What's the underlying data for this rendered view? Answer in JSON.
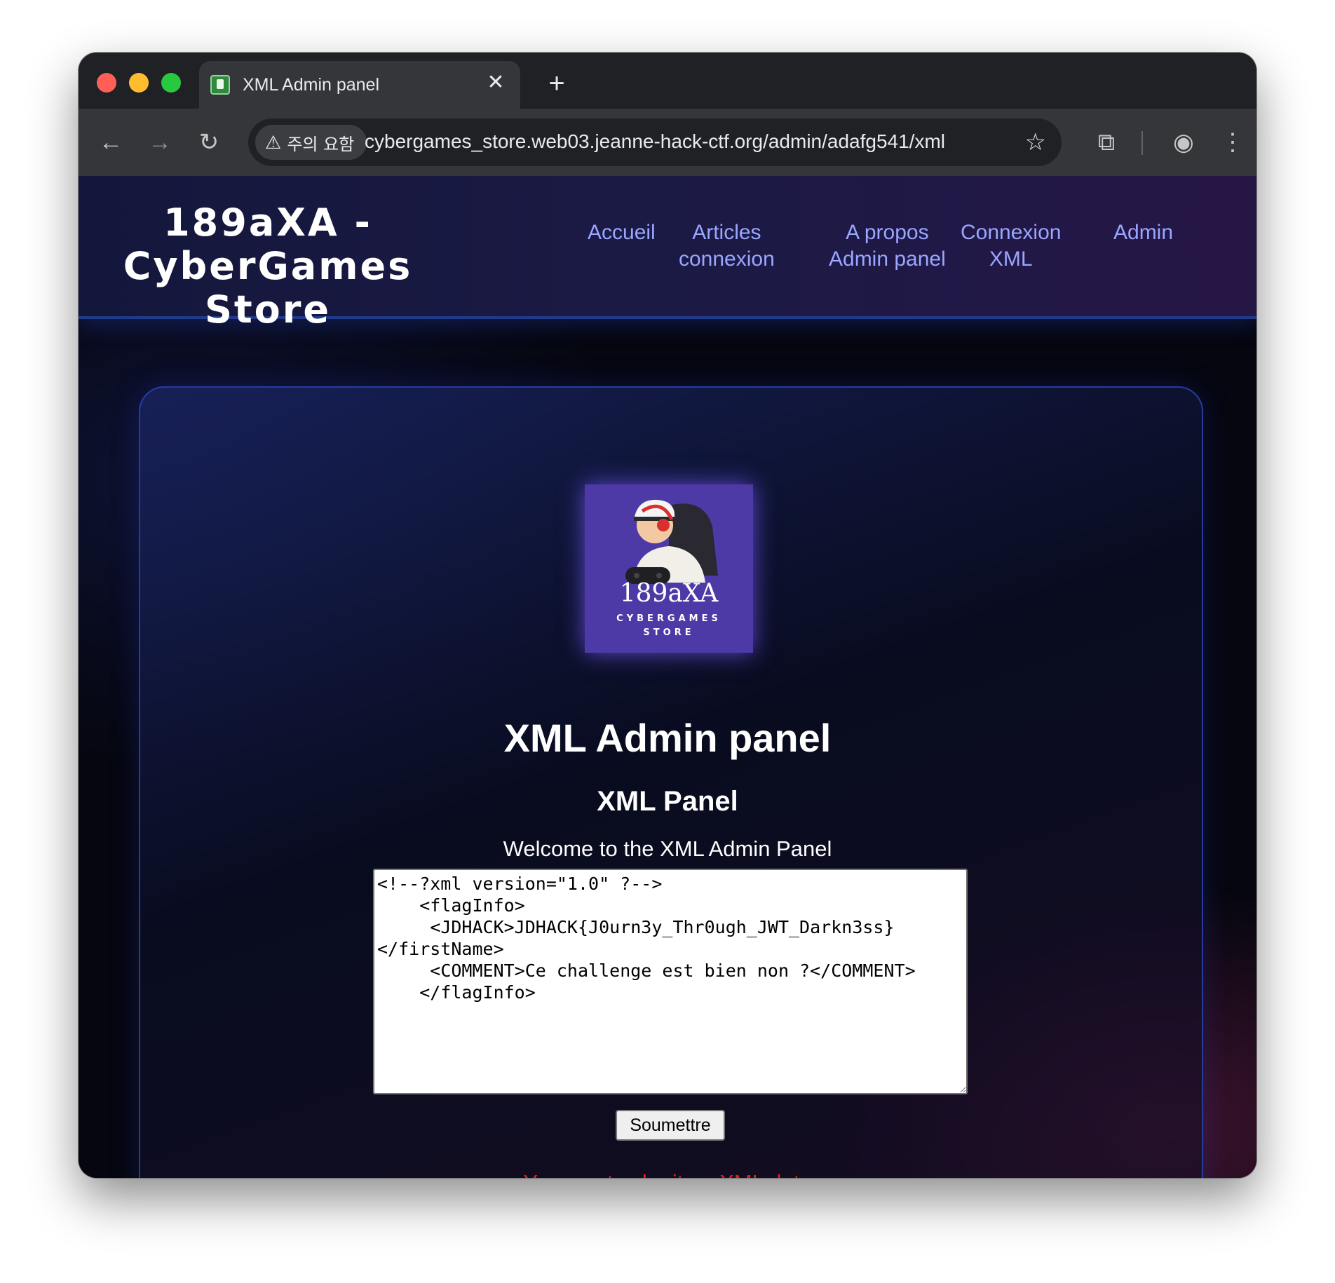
{
  "browser": {
    "tab_title": "XML Admin panel",
    "security_label": "주의 요함",
    "url": "cybergames_store.web03.jeanne-hack-ctf.org/admin/adafg541/xml",
    "close_glyph": "✕",
    "new_tab_glyph": "+",
    "back_glyph": "←",
    "forward_glyph": "→",
    "reload_glyph": "↻",
    "star_glyph": "☆",
    "warn_glyph": "⚠",
    "cast_glyph": "⧉",
    "profile_glyph": "◉",
    "menu_glyph": "⋮"
  },
  "header": {
    "brand_line1": "189aXA -",
    "brand_line2": "CyberGames Store",
    "nav": [
      {
        "line1": "Accueil",
        "line2": ""
      },
      {
        "line1": "Articles",
        "line2": "connexion"
      },
      {
        "line1": "A propos",
        "line2": "Admin panel"
      },
      {
        "line1": "Connexion",
        "line2": "XML"
      },
      {
        "line1": "Admin",
        "line2": ""
      }
    ]
  },
  "logo": {
    "name": "189aXA",
    "subtitle_line1": "CYBERGAMES",
    "subtitle_line2": "STORE"
  },
  "main": {
    "title": "XML Admin panel",
    "subtitle": "XML Panel",
    "welcome": "Welcome to the XML Admin Panel",
    "xml_value": "<!--?xml version=\"1.0\" ?-->\n    <flagInfo>\n     <JDHACK>JDHACK{J0urn3y_Thr0ugh_JWT_Darkn3ss}\n</firstName>\n     <COMMENT>Ce challenge est bien non ?</COMMENT>\n    </flagInfo>",
    "submit_label": "Soumettre",
    "error": "You must submit an XML data"
  },
  "colors": {
    "nav_link": "#9aa6ff",
    "error": "#ee1c1c",
    "logo_bg": "#4d3aa6",
    "card_border": "#273c9e"
  }
}
